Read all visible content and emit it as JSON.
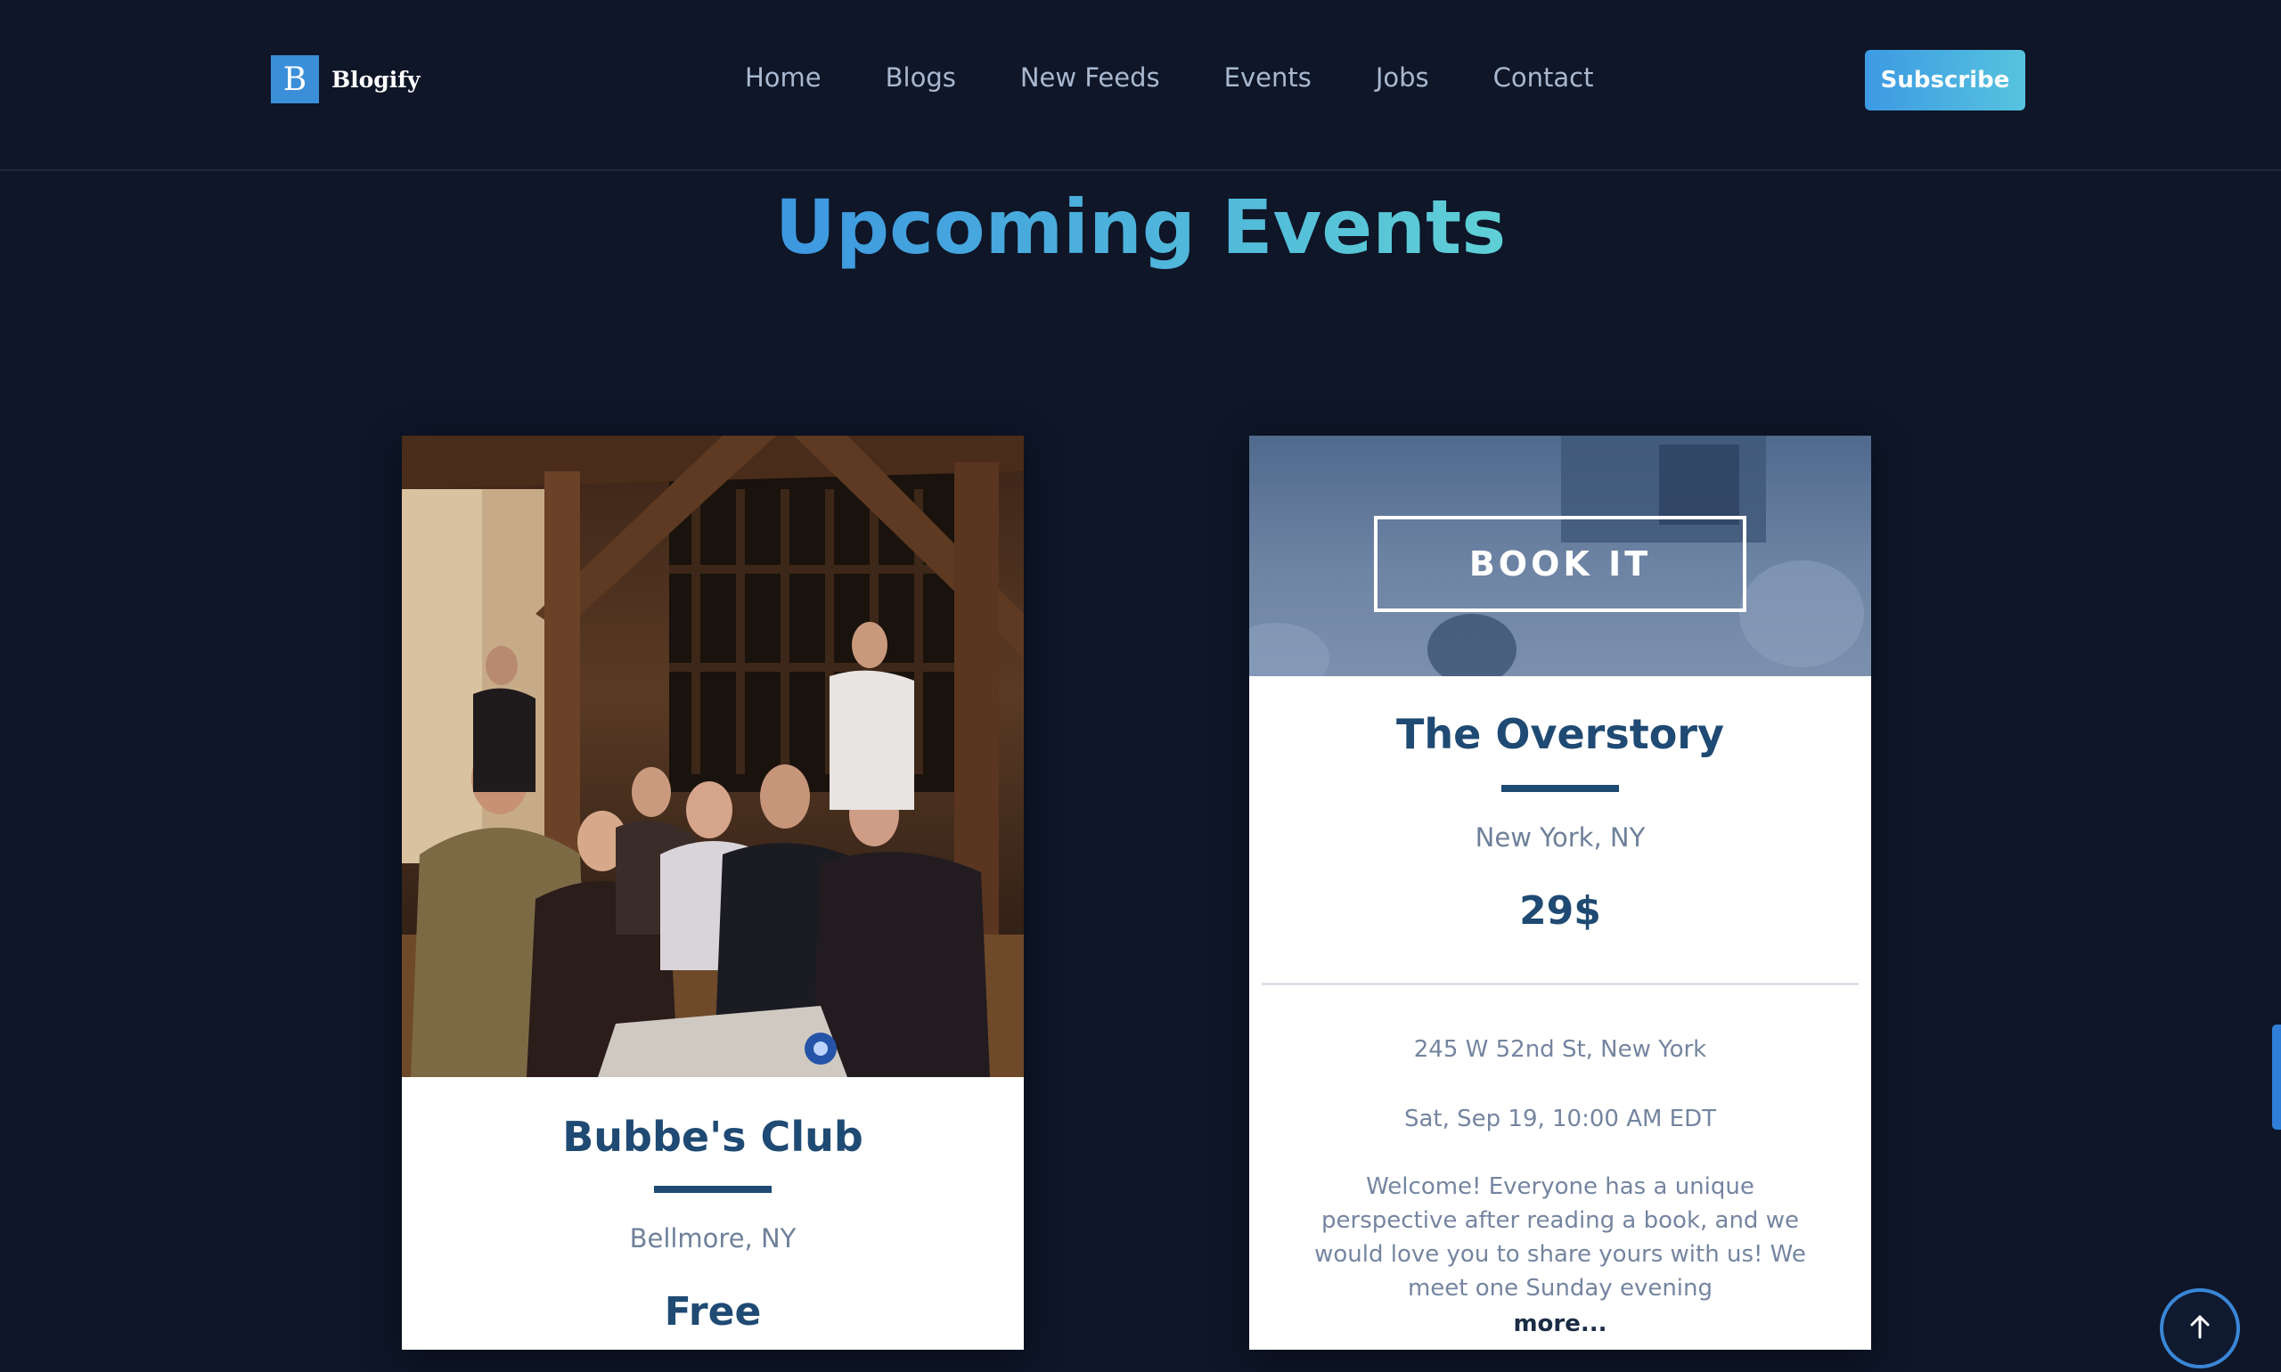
{
  "header": {
    "logo_letter": "B",
    "logo_text": "Blogify",
    "nav": [
      "Home",
      "Blogs",
      "New Feeds",
      "Events",
      "Jobs",
      "Contact"
    ],
    "subscribe_label": "Subscribe"
  },
  "section": {
    "title": "Upcoming Events"
  },
  "events": [
    {
      "title": "Bubbe's Club",
      "location": "Bellmore, NY",
      "price": "Free"
    },
    {
      "button_label": "BOOK IT",
      "title": "The Overstory",
      "location": "New York, NY",
      "price": "29$",
      "address": "245 W 52nd St, New York",
      "date": "Sat, Sep 19, 10:00 AM EDT",
      "description": "Welcome! Everyone has a unique perspective after reading a book, and we would love you to share yours with us! We meet one Sunday evening",
      "more_label": "more..."
    }
  ],
  "icons": {
    "scroll_top": "arrow-up-icon"
  },
  "colors": {
    "background": "#0e1628",
    "accent": "#3d9ae3",
    "card_title": "#1f4a73"
  }
}
